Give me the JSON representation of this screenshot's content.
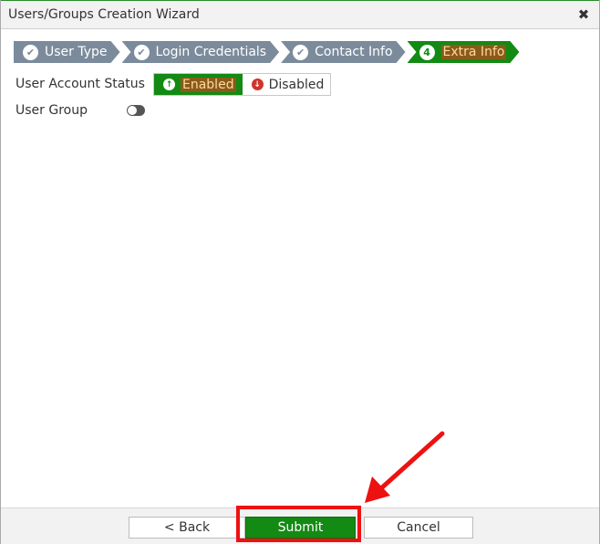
{
  "dialog": {
    "title": "Users/Groups Creation Wizard",
    "close_symbol": "✖"
  },
  "steps": [
    {
      "label": "User Type",
      "icon": "check-icon",
      "symbol": "✔",
      "state": "done"
    },
    {
      "label": "Login Credentials",
      "icon": "check-icon",
      "symbol": "✔",
      "state": "done"
    },
    {
      "label": "Contact Info",
      "icon": "check-icon",
      "symbol": "✔",
      "state": "done"
    },
    {
      "label": "Extra Info",
      "icon": "number-icon",
      "symbol": "4",
      "state": "active"
    }
  ],
  "form": {
    "account_status_label": "User Account Status",
    "enabled_label": "Enabled",
    "disabled_label": "Disabled",
    "enabled_symbol": "↑",
    "disabled_symbol": "↓",
    "user_group_label": "User Group",
    "user_group_toggle_on": false
  },
  "footer": {
    "back_label": "< Back",
    "submit_label": "Submit",
    "cancel_label": "Cancel"
  },
  "colors": {
    "accent": "#138a13",
    "step_done": "#7b8b9b",
    "annotation": "#ee1111"
  }
}
